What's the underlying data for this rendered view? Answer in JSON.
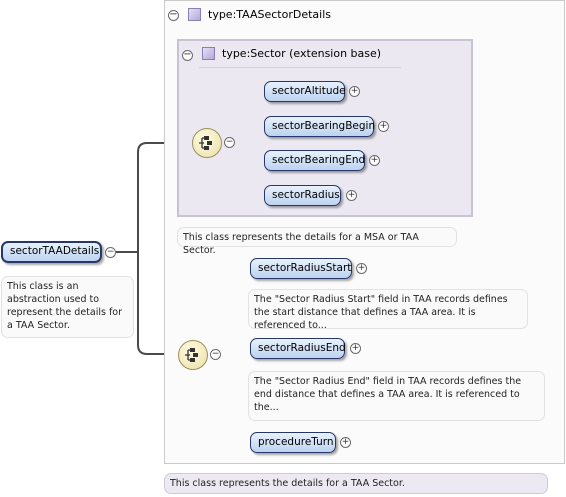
{
  "type_box": {
    "label": "type:TAASectorDetails",
    "collapse_symbol": "−"
  },
  "extension_box": {
    "label": "type:Sector (extension base)",
    "collapse_symbol": "−"
  },
  "root": {
    "label": "sectorTAADetails",
    "collapse_symbol": "−",
    "doc": "This class is an abstraction used to represent the details for a TAA Sector."
  },
  "sector_children": [
    {
      "label": "sectorAltitude"
    },
    {
      "label": "sectorBearingBegin"
    },
    {
      "label": "sectorBearingEnd"
    },
    {
      "label": "sectorRadius"
    }
  ],
  "sector_doc": "This class represents the details for a MSA or TAA Sector.",
  "taa_children": [
    {
      "label": "sectorRadiusStart",
      "doc": "The \"Sector Radius Start\" field in TAA records defines the start distance that defines a TAA area. It is referenced to..."
    },
    {
      "label": "sectorRadiusEnd",
      "doc": "The \"Sector Radius End\" field in TAA records defines the end distance that defines a TAA area. It is referenced to the..."
    },
    {
      "label": "procedureTurn"
    }
  ],
  "type_doc": "This class represents the details for a TAA Sector.",
  "expand_symbol": "+",
  "collapse_symbol": "−"
}
